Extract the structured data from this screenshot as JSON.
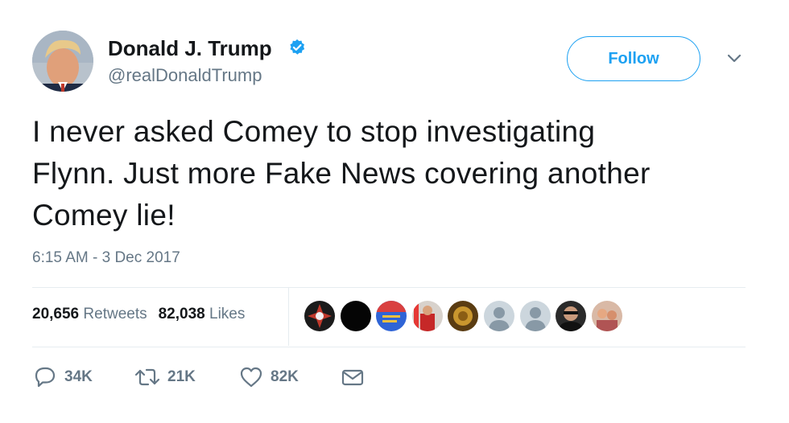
{
  "user": {
    "name": "Donald J. Trump",
    "handle": "@realDonaldTrump",
    "verified": true
  },
  "follow_label": "Follow",
  "tweet": {
    "lines": [
      "I never asked Comey to stop investigating",
      "Flynn. Just more Fake News covering another",
      "Comey lie!"
    ],
    "timestamp": "6:15 AM - 3 Dec 2017"
  },
  "stats": {
    "retweets_count": "20,656",
    "retweets_label": "Retweets",
    "likes_count": "82,038",
    "likes_label": "Likes"
  },
  "actions": {
    "reply_count": "34K",
    "retweet_count": "21K",
    "like_count": "82K"
  },
  "colors": {
    "brand": "#1da1f2",
    "text": "#14171a",
    "muted": "#657786",
    "divider": "#e6ecf0"
  },
  "icons": [
    "verified-badge-icon",
    "chevron-down-icon",
    "reply-icon",
    "retweet-icon",
    "heart-icon",
    "envelope-icon"
  ]
}
